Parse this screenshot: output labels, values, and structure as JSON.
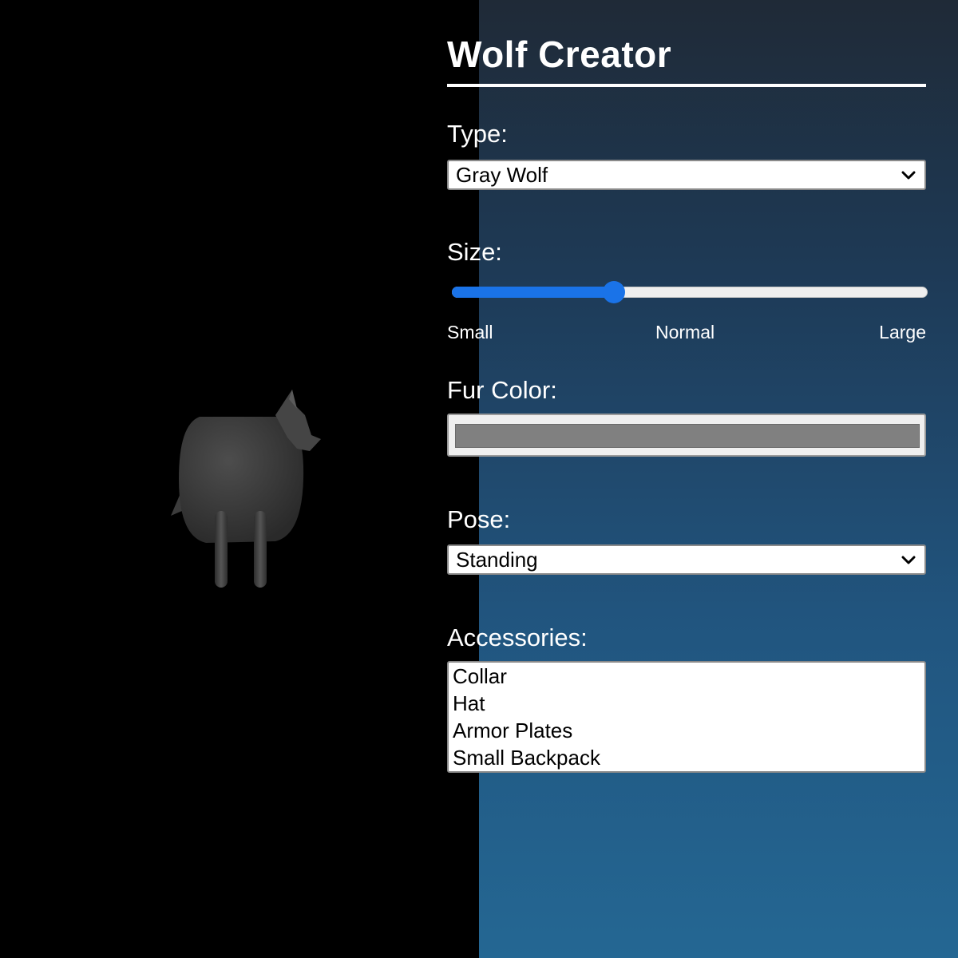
{
  "title": "Wolf Creator",
  "type": {
    "label": "Type:",
    "selected": "Gray Wolf"
  },
  "size": {
    "label": "Size:",
    "value_fraction": 0.34,
    "accent": "#1a73e8",
    "ticks": {
      "small": "Small",
      "normal": "Normal",
      "large": "Large"
    }
  },
  "fur_color": {
    "label": "Fur Color:",
    "value": "#808080"
  },
  "pose": {
    "label": "Pose:",
    "selected": "Standing"
  },
  "accessories": {
    "label": "Accessories:",
    "options": [
      "Collar",
      "Hat",
      "Armor Plates",
      "Small Backpack"
    ]
  },
  "icons": {
    "dropdown": "chevron-down-icon"
  }
}
